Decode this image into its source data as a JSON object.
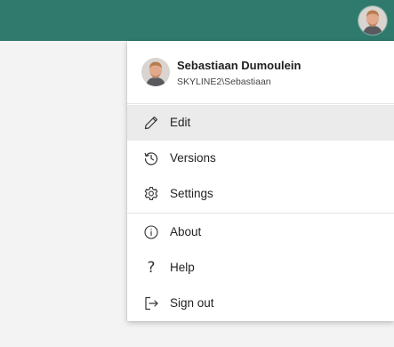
{
  "colors": {
    "topbar": "#2f7a6d",
    "menu_background": "#ffffff",
    "highlight": "#ebebeb",
    "page_background": "#f3f3f3"
  },
  "user": {
    "name": "Sebastiaan Dumoulein",
    "account": "SKYLINE2\\Sebastiaan"
  },
  "menu": {
    "items": [
      {
        "label": "Edit",
        "icon": "pencil-icon",
        "highlighted": true
      },
      {
        "label": "Versions",
        "icon": "history-icon"
      },
      {
        "label": "Settings",
        "icon": "gear-icon"
      },
      {
        "label": "About",
        "icon": "info-icon"
      },
      {
        "label": "Help",
        "icon": "question-icon"
      },
      {
        "label": "Sign out",
        "icon": "sign-out-icon"
      }
    ]
  }
}
